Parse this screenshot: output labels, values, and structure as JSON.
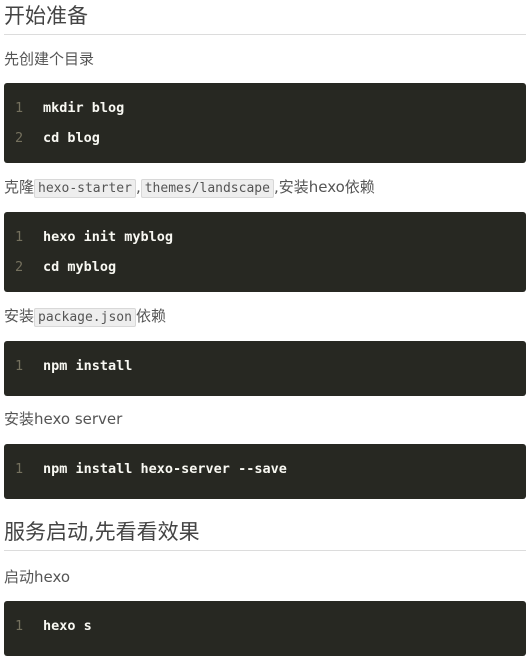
{
  "sections": [
    {
      "heading": "开始准备",
      "steps": [
        {
          "text": "先创建个目录",
          "code": [
            "mkdir blog",
            "cd blog"
          ]
        },
        {
          "text_parts": {
            "prefix": "克隆",
            "code1": "hexo-starter",
            "sep": ",",
            "code2": "themes/landscape",
            "suffix": ",安装hexo依赖"
          },
          "code": [
            "hexo init myblog",
            "cd myblog"
          ]
        },
        {
          "text_parts": {
            "prefix": "安装",
            "code1": "package.json",
            "suffix": "依赖"
          },
          "code": [
            "npm install"
          ]
        },
        {
          "text": "安装hexo server",
          "code": [
            "npm install hexo-server --save"
          ]
        }
      ]
    },
    {
      "heading": "服务启动,先看看效果",
      "steps": [
        {
          "text": "启动hexo",
          "code": [
            "hexo s"
          ]
        }
      ]
    }
  ],
  "line_numbers": [
    "1",
    "2"
  ]
}
